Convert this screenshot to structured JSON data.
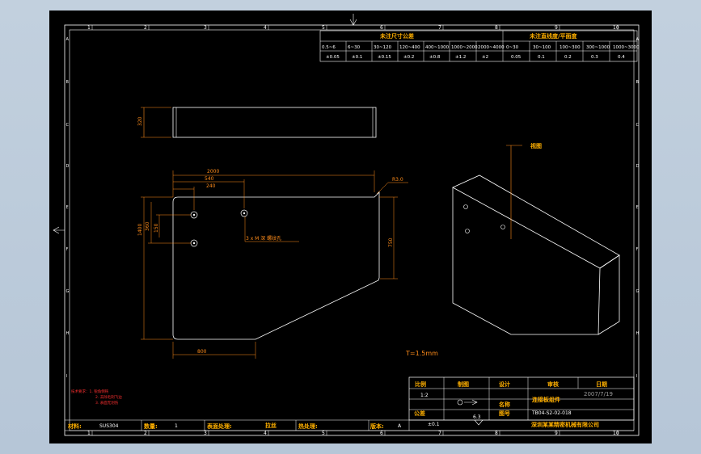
{
  "sheet": {
    "top_ruler": [
      "1",
      "2",
      "3",
      "4",
      "5",
      "6",
      "7",
      "8",
      "9",
      "10"
    ],
    "bottom_ruler": [
      "1",
      "2",
      "3",
      "4",
      "5",
      "6",
      "7",
      "8",
      "9",
      "10"
    ],
    "side_ruler": [
      "A",
      "B",
      "C",
      "D",
      "E",
      "F",
      "G",
      "H",
      "I"
    ]
  },
  "tolerance_table": {
    "linear_header": "未注尺寸公差",
    "flatness_header": "未注直线度/平面度",
    "linear_ranges": [
      "0.5~6",
      "6~30",
      "30~120",
      "120~400",
      "400~1000",
      "1000~2000",
      "2000~4000"
    ],
    "linear_values": [
      "±0.05",
      "±0.1",
      "±0.15",
      "±0.2",
      "±0.8",
      "±1.2",
      "±2"
    ],
    "flat_ranges": [
      "0~30",
      "30~100",
      "100~300",
      "300~1000",
      "1000~3000"
    ],
    "flat_values": [
      "0.05",
      "0.1",
      "0.2",
      "0.3",
      "0.4"
    ]
  },
  "side_view": {
    "dim_height": "320"
  },
  "front_view": {
    "dim_overall_width": "2000",
    "dim_540": "540",
    "dim_240": "240",
    "dim_radius": "R3.0",
    "dim_height": "1400",
    "dim_360": "360",
    "dim_150": "150",
    "dim_right": "750",
    "dim_bottom": "800",
    "hole_note": "3 x M  深 螺纹孔"
  },
  "iso_view": {
    "label": "视图"
  },
  "thickness": "T=1.5mm",
  "notes": [
    "技术要求：1. 锐角倒钝",
    "2. 去除毛刺飞边",
    "3. 表面无划伤"
  ],
  "title_block": {
    "ratio_label": "比例",
    "ratio_value": "1:2",
    "drawn_label": "制图",
    "design_label": "设计",
    "check_label": "审核",
    "date_label": "日期",
    "date_value": "2007/7/19",
    "name_label": "名称",
    "name_value": "连接板组件",
    "drawing_no_label": "图号",
    "drawing_no_value": "TB04-S2-02-018",
    "tolerance_label": "公差",
    "tolerance_value": "±0.1",
    "surface_value": "6.3",
    "company": "深圳某某精密机械有限公司",
    "material_label": "材料:",
    "material_value": "SUS304",
    "qty_label": "数量:",
    "qty_value": "1",
    "surface_label": "表面处理:",
    "surface_treatment": "拉丝",
    "heat_label": "热处理:",
    "version_label": "版本:",
    "version_value": "A"
  }
}
